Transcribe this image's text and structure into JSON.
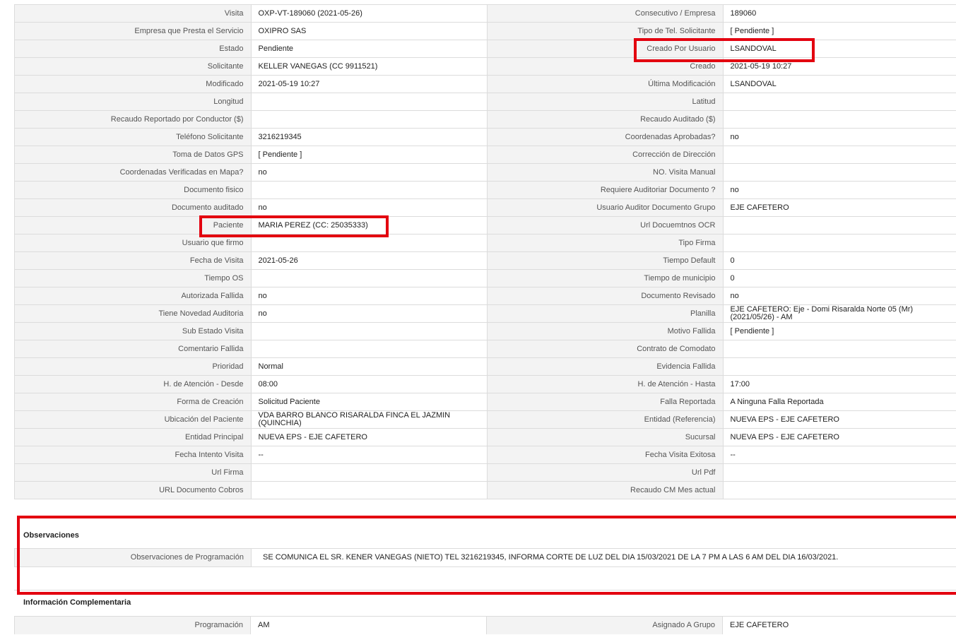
{
  "rows": [
    {
      "l1": "Visita",
      "v1": "OXP-VT-189060 (2021-05-26)",
      "l2": "Consecutivo / Empresa",
      "v2": "189060"
    },
    {
      "l1": "Empresa que Presta el Servicio",
      "v1": "OXIPRO SAS",
      "l2": "Tipo de Tel. Solicitante",
      "v2": "[ Pendiente ]"
    },
    {
      "l1": "Estado",
      "v1": "Pendiente",
      "l2": "Creado Por Usuario",
      "v2": "LSANDOVAL"
    },
    {
      "l1": "Solicitante",
      "v1": "KELLER VANEGAS (CC 9911521)",
      "l2": "Creado",
      "v2": "2021-05-19 10:27"
    },
    {
      "l1": "Modificado",
      "v1": "2021-05-19 10:27",
      "l2": "Última Modificación",
      "v2": " LSANDOVAL"
    },
    {
      "l1": "Longitud",
      "v1": "",
      "l2": "Latitud",
      "v2": ""
    },
    {
      "l1": "Recaudo Reportado por Conductor ($)",
      "v1": "",
      "l2": "Recaudo Auditado ($)",
      "v2": ""
    },
    {
      "l1": "Teléfono Solicitante",
      "v1": "3216219345",
      "l2": "Coordenadas Aprobadas?",
      "v2": " no"
    },
    {
      "l1": "Toma de Datos GPS",
      "v1": "[ Pendiente ]",
      "l2": "Corrección de Dirección",
      "v2": ""
    },
    {
      "l1": "Coordenadas Verificadas en Mapa?",
      "v1": " no",
      "l2": "NO. Visita Manual",
      "v2": ""
    },
    {
      "l1": "Documento fisico",
      "v1": "",
      "l2": "Requiere Auditoriar Documento ?",
      "v2": " no"
    },
    {
      "l1": "Documento auditado",
      "v1": " no",
      "l2": "Usuario Auditor Documento Grupo",
      "v2": "EJE CAFETERO"
    },
    {
      "l1": "Paciente",
      "v1": "MARIA PEREZ (CC: 25035333)",
      "l2": "Url Docuemtnos OCR",
      "v2": ""
    },
    {
      "l1": "Usuario que firmo",
      "v1": "",
      "l2": "Tipo Firma",
      "v2": ""
    },
    {
      "l1": "Fecha de Visita",
      "v1": " 2021-05-26",
      "l2": "Tiempo Default",
      "v2": "0"
    },
    {
      "l1": "Tiempo OS",
      "v1": "",
      "l2": "Tiempo de municipio",
      "v2": "0"
    },
    {
      "l1": "Autorizada Fallida",
      "v1": " no",
      "l2": "Documento Revisado",
      "v2": " no"
    },
    {
      "l1": "Tiene Novedad Auditoria",
      "v1": " no",
      "l2": "Planilla",
      "v2": "EJE CAFETERO: Eje - Domi Risaralda Norte 05 (Mr) (2021/05/26) - AM"
    },
    {
      "l1": "Sub Estado Visita",
      "v1": "",
      "l2": "Motivo Fallida",
      "v2": "[ Pendiente ]"
    },
    {
      "l1": "Comentario Fallida",
      "v1": "",
      "l2": "Contrato de Comodato",
      "v2": ""
    },
    {
      "l1": "Prioridad",
      "v1": "Normal",
      "l2": "Evidencia Fallida",
      "v2": ""
    },
    {
      "l1": "H. de Atención - Desde",
      "v1": "08:00",
      "l2": "H. de Atención - Hasta",
      "v2": "17:00"
    },
    {
      "l1": "Forma de Creación",
      "v1": "Solicitud Paciente",
      "l2": "Falla Reportada",
      "v2": "A Ninguna Falla Reportada"
    },
    {
      "l1": "Ubicación del Paciente",
      "v1": "VDA BARRO BLANCO RISARALDA FINCA EL JAZMIN (QUINCHIA)",
      "l2": "Entidad (Referencia)",
      "v2": "NUEVA EPS - EJE CAFETERO"
    },
    {
      "l1": "Entidad Principal",
      "v1": "NUEVA EPS - EJE CAFETERO",
      "l2": "Sucursal",
      "v2": "NUEVA EPS - EJE CAFETERO"
    },
    {
      "l1": "Fecha Intento Visita",
      "v1": " --",
      "l2": "Fecha Visita Exitosa",
      "v2": " --"
    },
    {
      "l1": "Url Firma",
      "v1": "",
      "l2": "Url Pdf",
      "v2": ""
    },
    {
      "l1": "URL Documento Cobros",
      "v1": "",
      "l2": "Recaudo CM Mes actual",
      "v2": ""
    }
  ],
  "observaciones": {
    "title": "Observaciones",
    "label": "Observaciones de Programación",
    "value": "SE COMUNICA EL SR. KENER VANEGAS (NIETO) TEL 3216219345, INFORMA CORTE DE LUZ DEL DIA 15/03/2021 DE LA 7 PM A LAS 6 AM DEL DIA 16/03/2021."
  },
  "complementaria": {
    "title": "Información Complementaria",
    "l1": "Programación",
    "v1": "AM",
    "l2": "Asignado A Grupo",
    "v2": "EJE CAFETERO"
  },
  "highlight_color": "#e3000f"
}
